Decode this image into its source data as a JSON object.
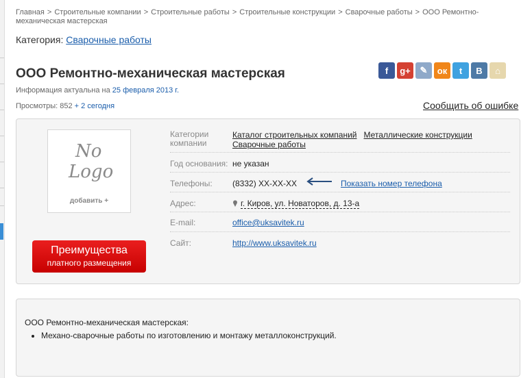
{
  "breadcrumb": [
    "Главная",
    "Строительные компании",
    "Строительные работы",
    "Строительные конструкции",
    "Сварочные работы",
    "ООО Ремонтно-механическая мастерская"
  ],
  "breadcrumb_sep": ">",
  "category": {
    "label": "Категория:",
    "link": "Сварочные работы"
  },
  "title": "ООО Ремонтно-механическая мастерская",
  "actuality": {
    "text": "Информация актуальна на",
    "date": "25 февраля 2013 г."
  },
  "views": {
    "text": "Просмотры: 852",
    "today": "+ 2 сегодня"
  },
  "report_error": "Сообщить об ошибке",
  "social": [
    {
      "icon": "facebook-icon",
      "glyph": "f",
      "color": "#3b5998"
    },
    {
      "icon": "google-plus-icon",
      "glyph": "g+",
      "color": "#d44132"
    },
    {
      "icon": "livejournal-icon",
      "glyph": "✎",
      "color": "#8fa9c9"
    },
    {
      "icon": "odnoklassniki-icon",
      "glyph": "ок",
      "color": "#f0861a"
    },
    {
      "icon": "twitter-icon",
      "glyph": "t",
      "color": "#3fa2e0"
    },
    {
      "icon": "vkontakte-icon",
      "glyph": "В",
      "color": "#4e7aa6"
    },
    {
      "icon": "bookmark-icon",
      "glyph": "⌂",
      "color": "#e6d7ad"
    }
  ],
  "logo": {
    "line1": "No",
    "line2": "Logo",
    "add": "добавить +"
  },
  "benefits_button": {
    "line1": "Преимущества",
    "line2": "платного размещения"
  },
  "info": {
    "categories_label": "Категории компании",
    "categories": [
      "Каталог строительных компаний",
      "Металлические конструкции",
      "Сварочные работы"
    ],
    "founded_label": "Год основания:",
    "founded_value": "не указан",
    "phones_label": "Телефоны:",
    "phone_value": "(8332) XX-XX-XX",
    "show_phone": "Показать номер телефона",
    "address_label": "Адрес:",
    "address_value": "г. Киров, ул. Новаторов, д. 13-а",
    "email_label": "E-mail:",
    "email_value": "office@uksavitek.ru",
    "site_label": "Сайт:",
    "site_value": "http://www.uksavitek.ru"
  },
  "description": {
    "head": "ООО Ремонтно-механическая мастерская:",
    "items": [
      "Механо-сварочные работы по изготовлению и монтажу металлоконструкций."
    ]
  },
  "colors": {
    "link": "#1a5dab",
    "button": "#d60a0a",
    "panel_bg": "#f5f5f5"
  }
}
